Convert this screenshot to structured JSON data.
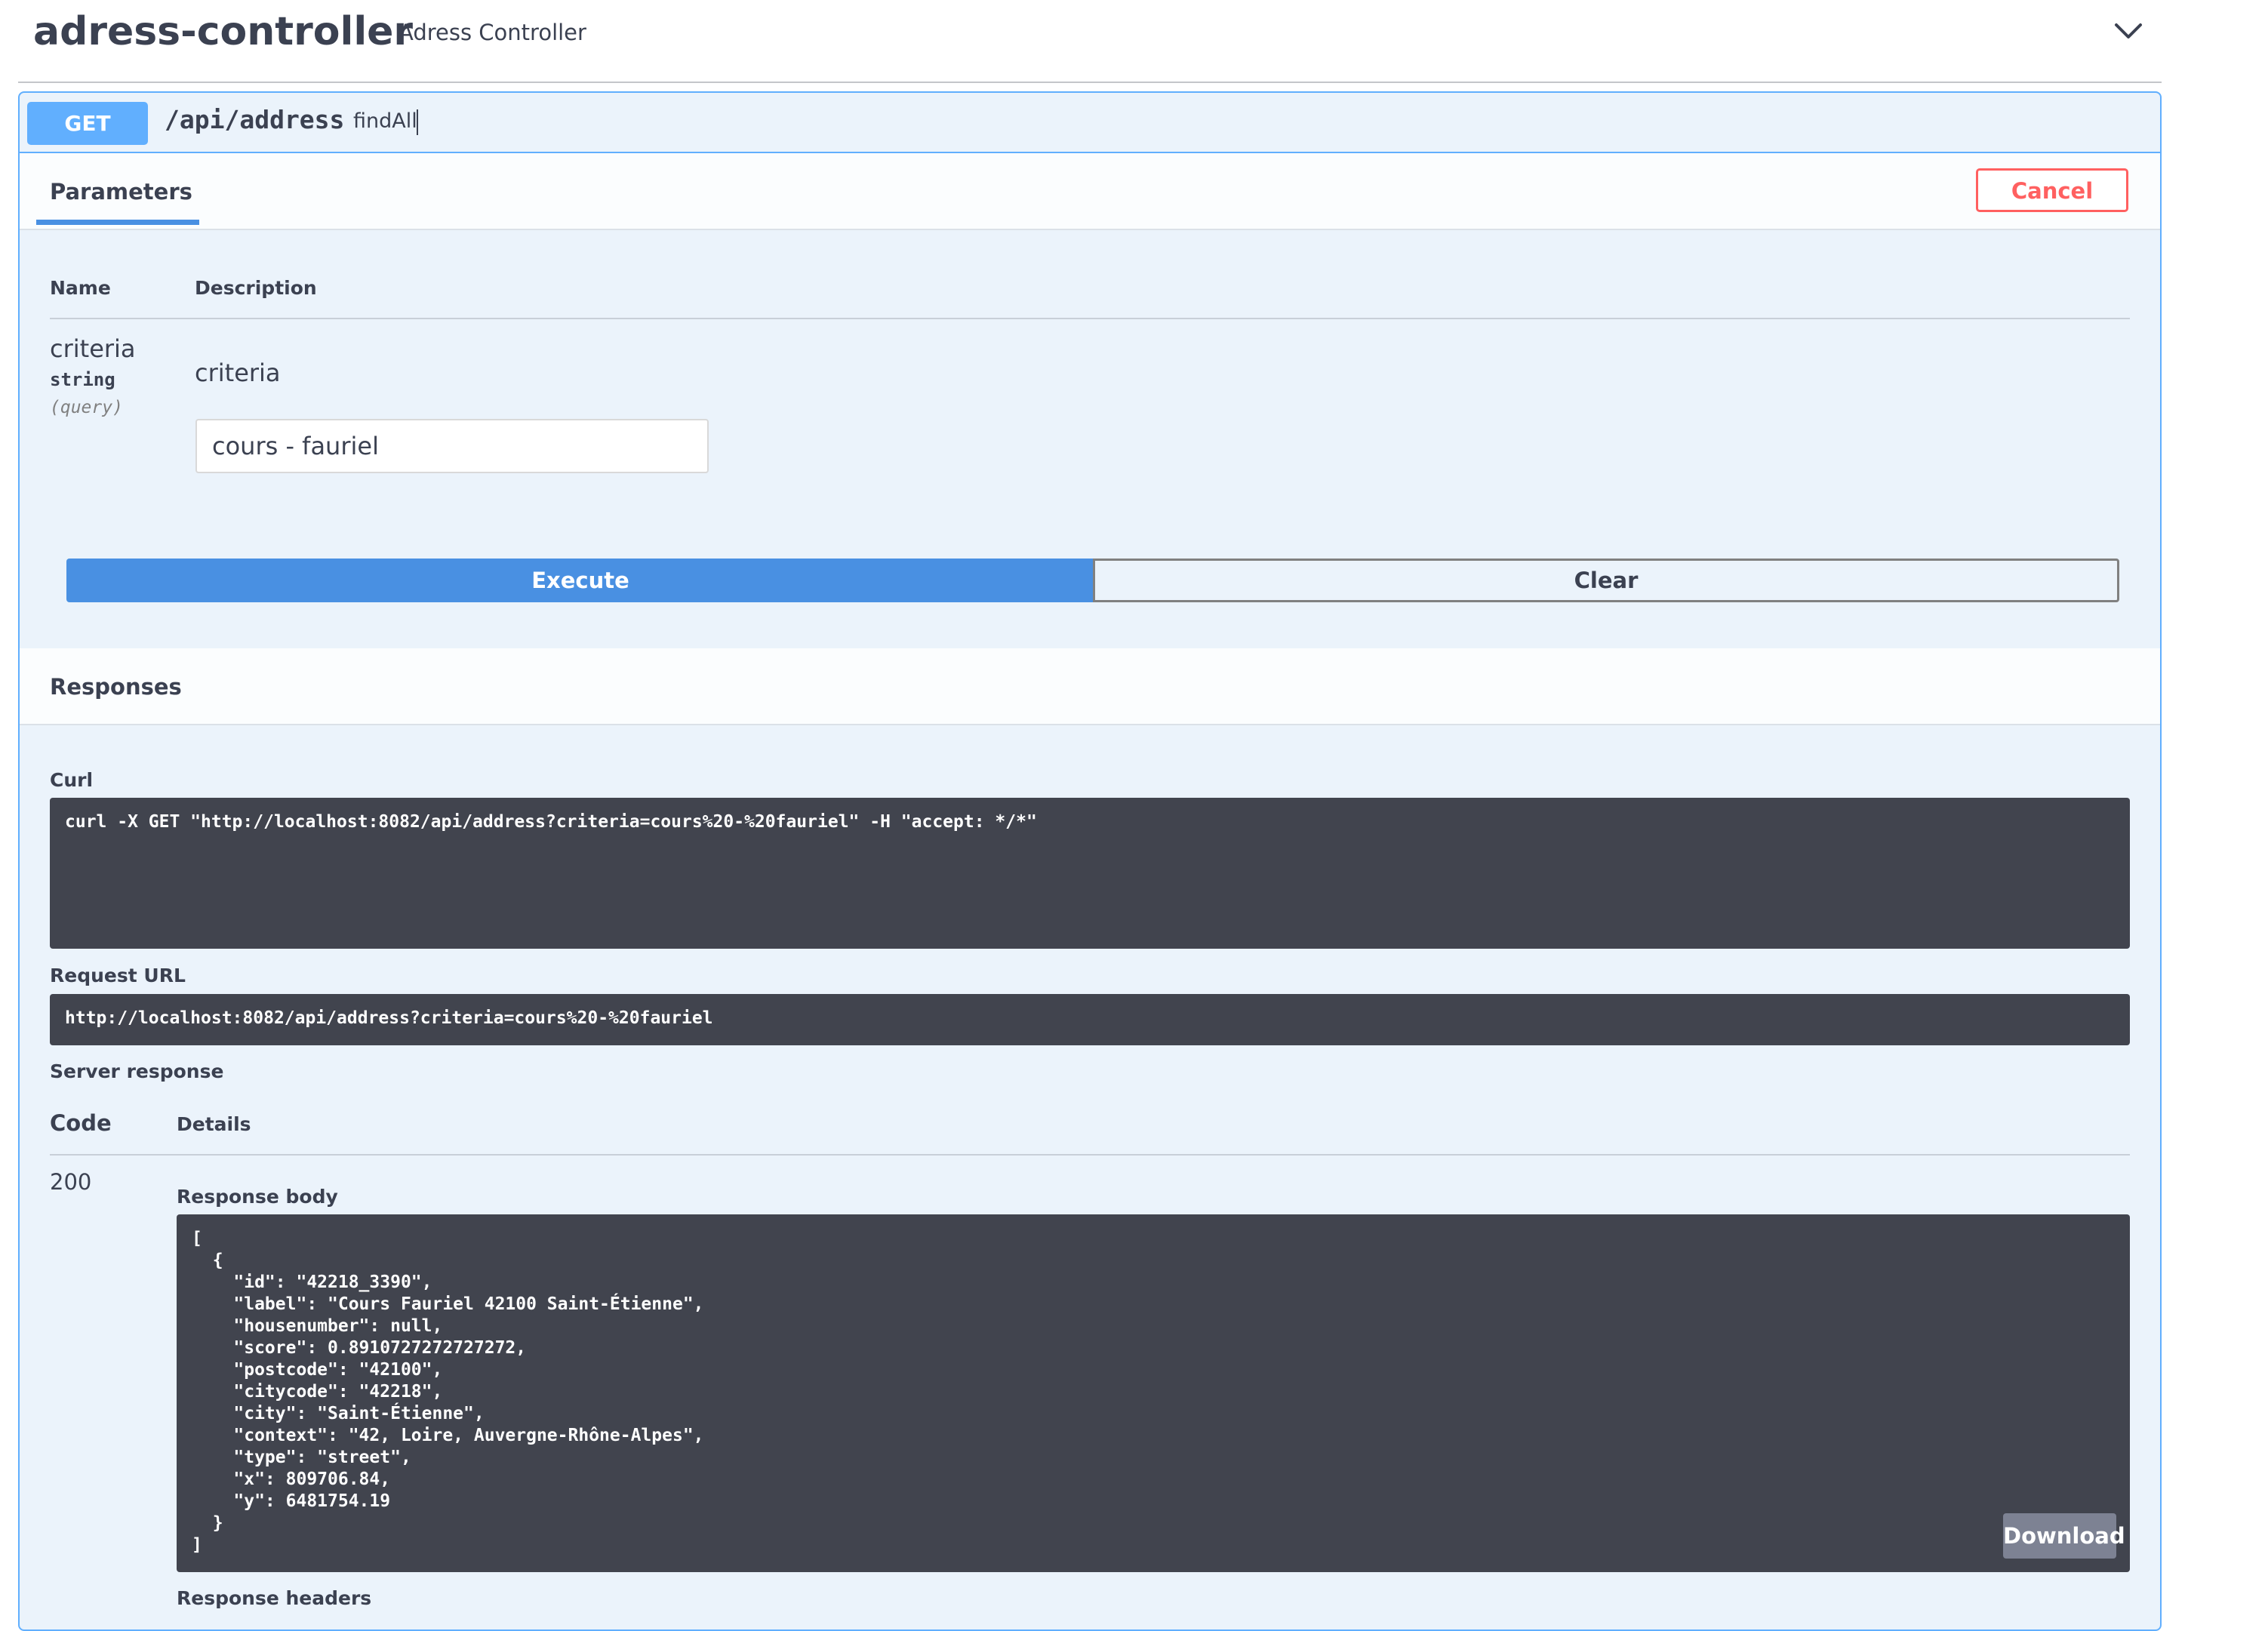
{
  "controller": {
    "title": "adress-controller",
    "description": "Adress Controller"
  },
  "operation": {
    "method": "GET",
    "path": "/api/address",
    "operation_id": "findAll",
    "tab_label": "Parameters",
    "cancel_label": "Cancel"
  },
  "parameters": {
    "header_name": "Name",
    "header_description": "Description",
    "items": [
      {
        "name": "criteria",
        "type": "string",
        "in": "(query)",
        "description": "criteria",
        "value": "cours - fauriel"
      }
    ]
  },
  "actions": {
    "execute_label": "Execute",
    "clear_label": "Clear"
  },
  "responses": {
    "title": "Responses",
    "curl_label": "Curl",
    "curl_command": "curl -X GET \"http://localhost:8082/api/address?criteria=cours%20-%20fauriel\" -H \"accept: */*\"",
    "request_url_label": "Request URL",
    "request_url": "http://localhost:8082/api/address?criteria=cours%20-%20fauriel",
    "server_response_label": "Server response",
    "code_header": "Code",
    "details_header": "Details",
    "code": "200",
    "response_body_label": "Response body",
    "response_body": "[\n  {\n    \"id\": \"42218_3390\",\n    \"label\": \"Cours Fauriel 42100 Saint-Étienne\",\n    \"housenumber\": null,\n    \"score\": 0.8910727272727272,\n    \"postcode\": \"42100\",\n    \"citycode\": \"42218\",\n    \"city\": \"Saint-Étienne\",\n    \"context\": \"42, Loire, Auvergne-Rhône-Alpes\",\n    \"type\": \"street\",\n    \"x\": 809706.84,\n    \"y\": 6481754.19\n  }\n]",
    "download_label": "Download",
    "response_headers_label": "Response headers"
  },
  "icons": {
    "collapse": "chevron-down-icon"
  },
  "colors": {
    "get_method": "#61affe",
    "execute": "#4990e2",
    "cancel": "#ff6060",
    "code_bg": "#41444e"
  }
}
